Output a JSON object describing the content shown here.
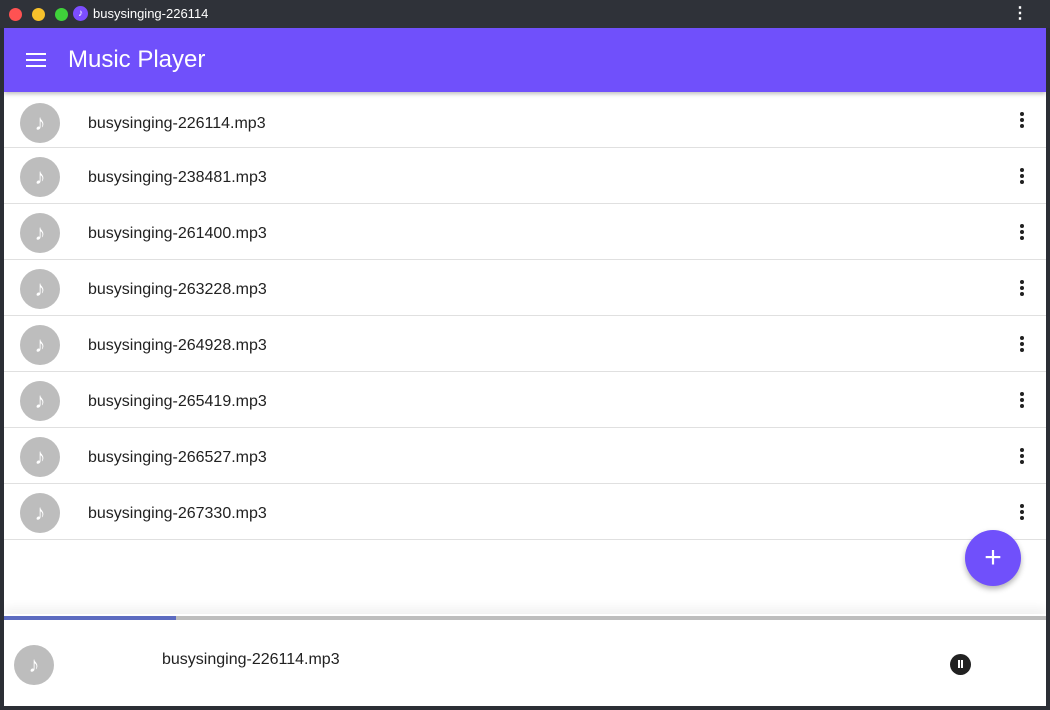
{
  "window": {
    "title": "busysinging-226114",
    "app_icon": "music-note-icon",
    "menu_icon": "more-vertical-icon"
  },
  "appbar": {
    "title": "Music Player",
    "menu_icon": "hamburger-menu-icon",
    "color": "#7050fb"
  },
  "tracks": [
    {
      "title": "busysinging-226114.mp3"
    },
    {
      "title": "busysinging-238481.mp3"
    },
    {
      "title": "busysinging-261400.mp3"
    },
    {
      "title": "busysinging-263228.mp3"
    },
    {
      "title": "busysinging-264928.mp3"
    },
    {
      "title": "busysinging-265419.mp3"
    },
    {
      "title": "busysinging-266527.mp3"
    },
    {
      "title": "busysinging-267330.mp3"
    }
  ],
  "fab": {
    "label": "+",
    "icon": "add-icon"
  },
  "player": {
    "now_playing": "busysinging-226114.mp3",
    "progress": 0.165,
    "state_icon": "pause-icon"
  }
}
